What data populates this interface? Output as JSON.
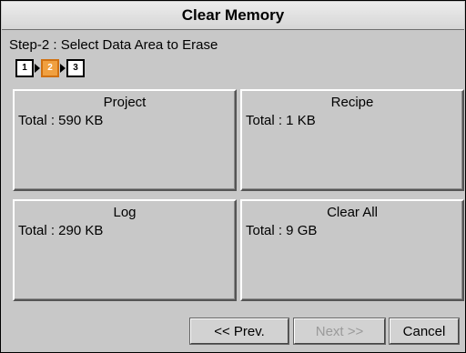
{
  "dialog": {
    "title": "Clear Memory",
    "step_label": "Step-2 : Select Data Area to Erase"
  },
  "steps": {
    "labels": [
      "1",
      "2",
      "3"
    ],
    "current": 2
  },
  "tiles": [
    {
      "title": "Project",
      "total": "Total : 590 KB"
    },
    {
      "title": "Recipe",
      "total": "Total : 1 KB"
    },
    {
      "title": "Log",
      "total": "Total : 290 KB"
    },
    {
      "title": "Clear All",
      "total": "Total : 9 GB"
    }
  ],
  "buttons": {
    "prev": "<< Prev.",
    "next": "Next >>",
    "cancel": "Cancel"
  },
  "colors": {
    "active_step": "#f0a040",
    "window_bg": "#c8c8c8"
  }
}
